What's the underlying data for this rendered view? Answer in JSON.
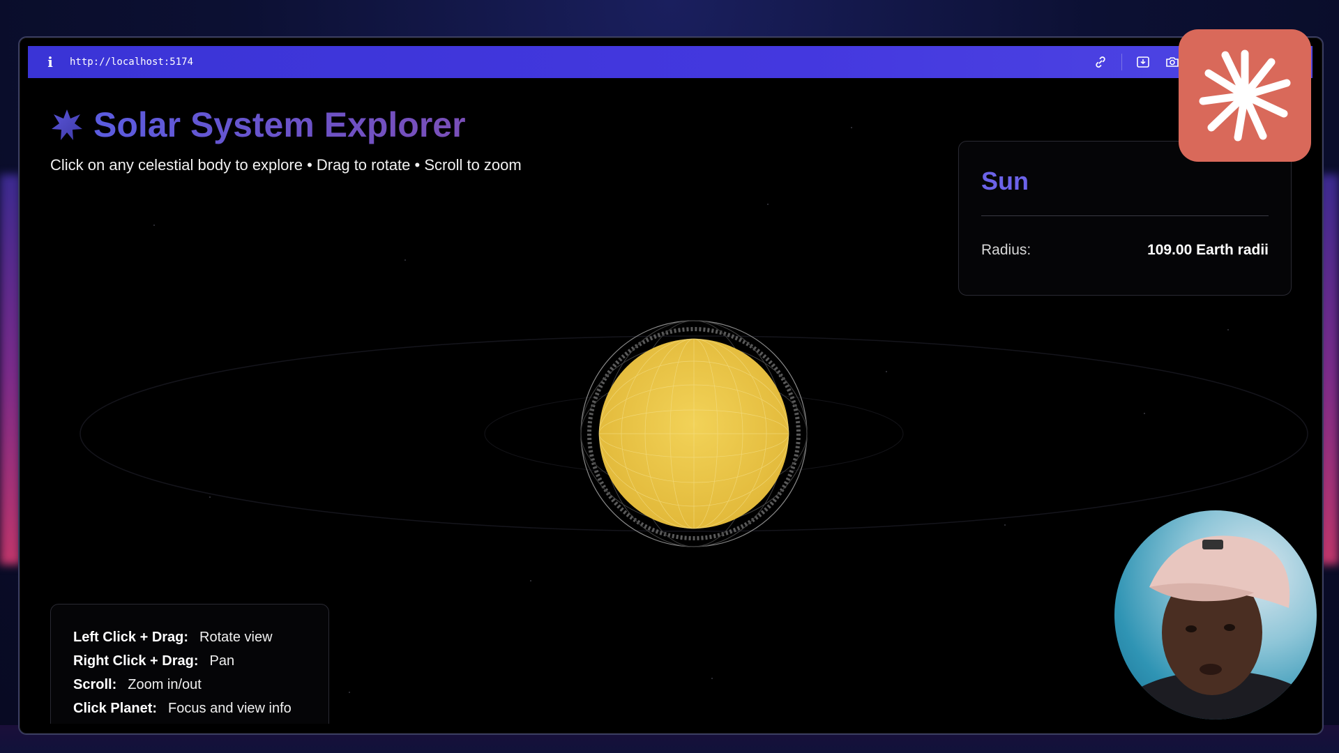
{
  "browser": {
    "url": "http://localhost:5174",
    "actions": [
      "link-icon",
      "screenshot-region-icon",
      "camera-icon"
    ]
  },
  "header": {
    "title": "Solar System Explorer",
    "subtitle": "Click on any celestial body to explore • Drag to rotate • Scroll to zoom"
  },
  "info_panel": {
    "name": "Sun",
    "rows": [
      {
        "label": "Radius:",
        "value": "109.00 Earth radii"
      }
    ]
  },
  "controls": [
    {
      "key": "Left Click + Drag:",
      "action": "Rotate view"
    },
    {
      "key": "Right Click + Drag:",
      "action": "Pan"
    },
    {
      "key": "Scroll:",
      "action": "Zoom in/out"
    },
    {
      "key": "Click Planet:",
      "action": "Focus and view info"
    }
  ],
  "colors": {
    "accent": "#6c63e8",
    "urlbar": "#4438df",
    "sun": "#e9c441",
    "logo": "#d9695a"
  }
}
